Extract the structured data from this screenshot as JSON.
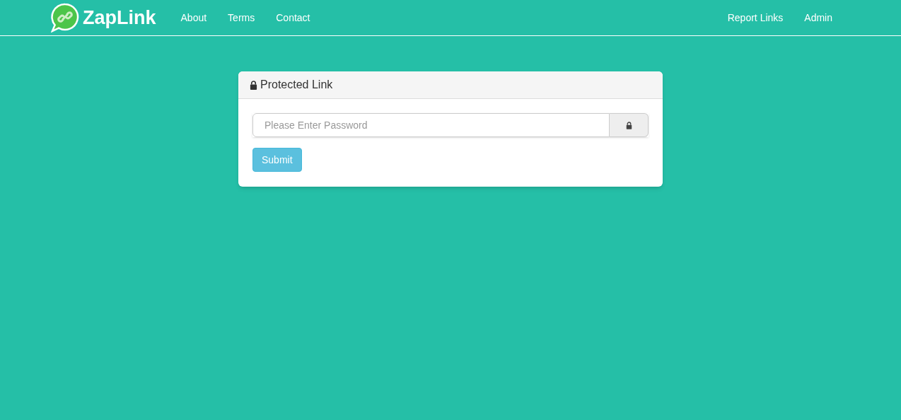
{
  "navbar": {
    "brand": "ZapLink",
    "left_links": [
      "About",
      "Terms",
      "Contact"
    ],
    "right_links": [
      "Report Links",
      "Admin"
    ]
  },
  "panel": {
    "title": "Protected Link",
    "password": {
      "placeholder": "Please Enter Password"
    },
    "submit": "Submit"
  }
}
